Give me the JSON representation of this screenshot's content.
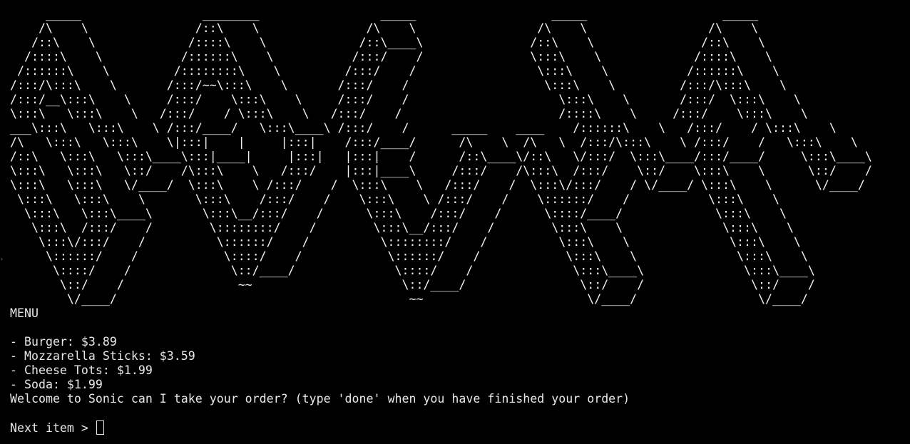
{
  "banner": {
    "ascii_art": "     _____                 ________                 _____                   _____                   _____\n    /\\    \\               /::\\    \\               /\\    \\                 /\\    \\                 /\\    \\\n   /::\\    \\             /::::\\    \\             /::\\____\\               /::\\    \\               /::\\    \\\n  /::::\\    \\           /::::::\\    \\           /:::/    /               \\:::\\    \\             /::::\\    \\\n /::::::\\    \\         /::::::::\\    \\         /:::/    /                 \\:::\\    \\           /::::::\\    \\\n/:::/\\:::\\    \\       /:::/~~\\:::\\    \\       /:::/    /                   \\:::\\    \\         /:::/\\:::\\    \\\n/:::/__\\:::\\    \\     /:::/    \\:::\\    \\     /:::/    /                     \\:::\\    \\       /:::/  \\:::\\    \\\n\\:::\\   \\:::\\    \\   /:::/    / \\:::\\    \\   /:::/    /                      /::::\\    \\     /:::/    \\:::\\    \\\n___\\:::\\   \\:::\\    \\ /:::/____/   \\:::\\____\\ /:::/    /      _____    ____    /::::::\\    \\   /:::/    / \\:::\\    \\\n/\\   \\:::\\   \\:::\\    \\|:::|    |     |:::|    /:::/____/      /\\    \\  /\\   \\  /:::/\\:::\\    \\ /:::/    /   \\:::\\    \\\n/::\\   \\:::\\   \\:::\\____\\:::|____|     |:::|   |:::|    /      /::\\____\\/::\\   \\/:::/  \\:::\\____/:::/____/     \\:::\\____\\\n\\:::\\   \\:::\\   \\::/    /\\:::\\    \\   /:::/    |:::|____\\     /:::/    /\\:::\\  /:::/    \\::/    \\:::\\    \\      \\::/    /\n\\:::\\   \\:::\\   \\/____/  \\:::\\    \\ /:::/    /  \\:::\\    \\   /:::/    /  \\:::\\/:::/    / \\/____/ \\:::\\    \\      \\/____/\n \\:::\\   \\:::\\    \\       \\:::\\    /:::/    /    \\:::\\    \\ /:::/    /    \\::::::/    /           \\:::\\    \\\n  \\:::\\   \\:::\\____\\       \\:::\\__/:::/    /      \\:::\\    /:::/    /      \\::::/____/             \\:::\\    \\\n   \\:::\\  /:::/    /        \\::::::::/    /        \\:::\\__/:::/    /        \\:::\\    \\              \\:::\\    \\\n    \\:::\\/:::/    /          \\::::::/    /          \\::::::::/    /          \\:::\\    \\              \\:::\\    \\\n     \\::::::/    /            \\::::/    /            \\::::::/    /            \\:::\\    \\              \\:::\\    \\\n      \\::::/    /              \\::/____/              \\::::/    /              \\:::\\____\\              \\:::\\____\\\n       \\::/    /                ~~                     \\::/____/                \\::/    /               \\::/    /\n        \\/____/                                         ~~                       \\/____/                 \\/____/"
  },
  "menu": {
    "title": "MENU",
    "items": [
      "- Burger: $3.89",
      "- Mozzarella Sticks: $3.59",
      "- Cheese Tots: $1.99",
      "- Soda: $1.99"
    ]
  },
  "welcome_message": "Welcome to Sonic can I take your order? (type 'done' when you have finished your order)",
  "prompt": {
    "label": "Next item > ",
    "value": ""
  },
  "colors": {
    "background": "#000000",
    "foreground": "#e8e8e8"
  }
}
